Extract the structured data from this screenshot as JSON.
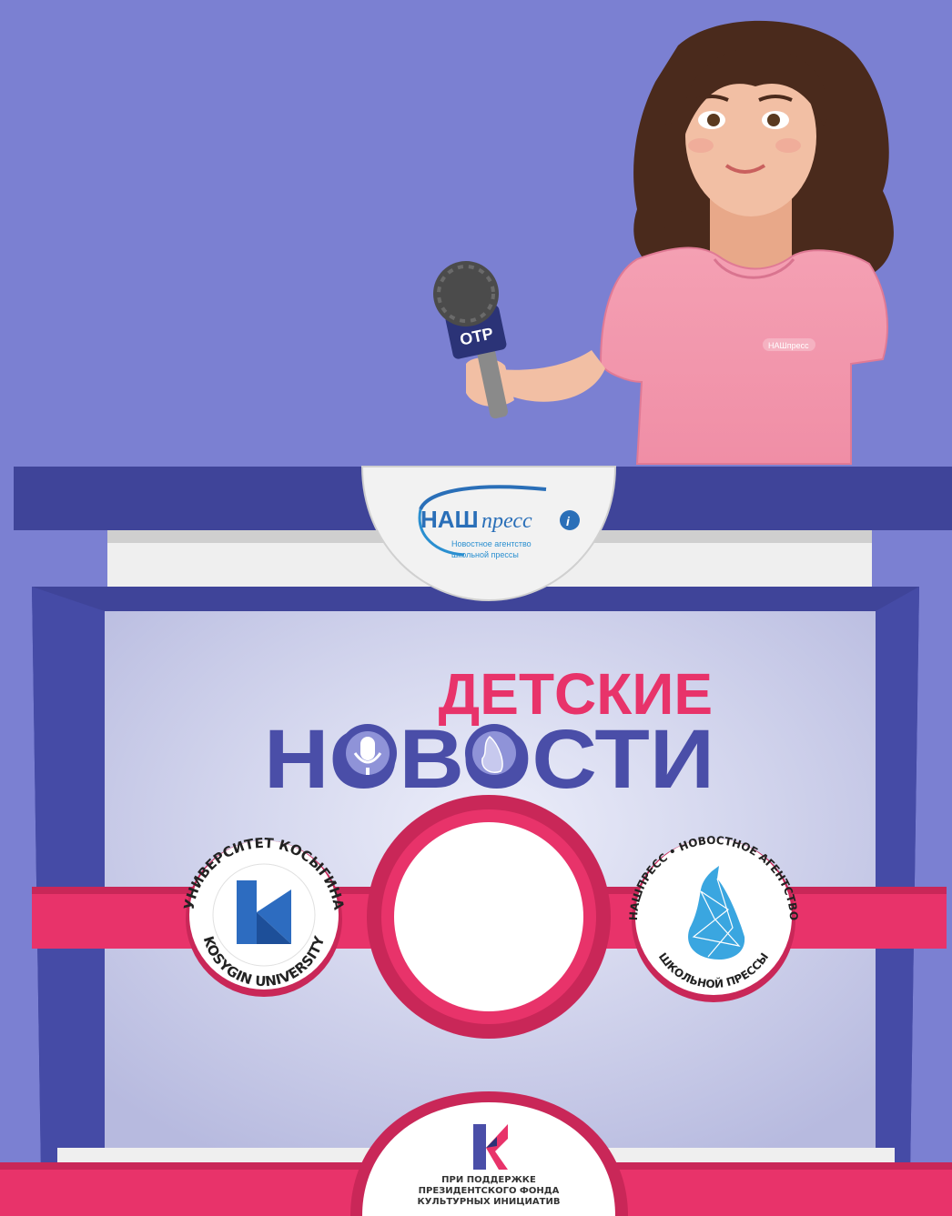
{
  "microphone": {
    "brand": "OTP"
  },
  "shirt": {
    "logo": "НАШпресс"
  },
  "top_badge": {
    "word_nash": "НАШ",
    "word_press": "пресс",
    "subtitle_line1": "Новостное агентство",
    "subtitle_line2": "школьной прессы"
  },
  "title": {
    "line1": "ДЕТСКИЕ",
    "line2": "НОВОСТИ"
  },
  "left_seal": {
    "top_arc": "УНИВЕРСИТЕТ КОСЫГИНА",
    "bottom_arc": "KOSYGIN UNIVERSITY"
  },
  "right_seal": {
    "top_arc": "НАШПРЕСС • НОВОСТНОЕ АГЕНТСТВО",
    "bottom_arc": "ШКОЛЬНОЙ ПРЕССЫ"
  },
  "bottom_badge": {
    "line1": "ПРИ ПОДДЕРЖКЕ",
    "line2": "ПРЕЗИДЕНТСКОГО ФОНДА",
    "line3": "КУЛЬТУРНЫХ ИНИЦИАТИВ"
  },
  "colors": {
    "background": "#7b80d2",
    "desk_blue": "#3f4499",
    "desk_pink": "#e8336a",
    "panel": "#c9cbe8"
  }
}
